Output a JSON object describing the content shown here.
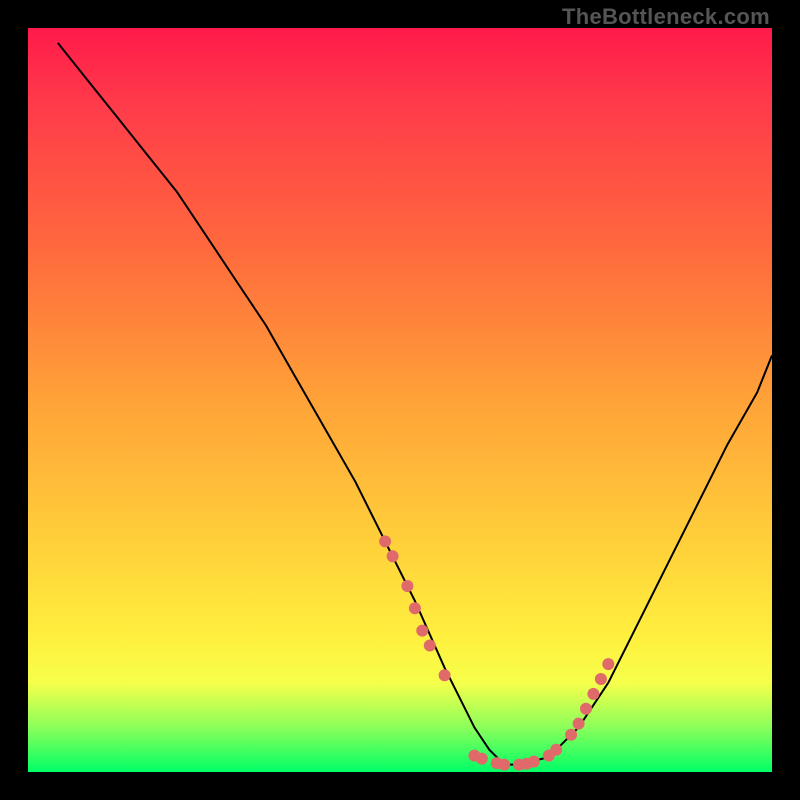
{
  "watermark": "TheBottleneck.com",
  "chart_data": {
    "type": "line",
    "title": "",
    "xlabel": "",
    "ylabel": "",
    "xlim": [
      0,
      100
    ],
    "ylim": [
      0,
      100
    ],
    "series": [
      {
        "name": "curve",
        "x": [
          4,
          8,
          12,
          16,
          20,
          24,
          28,
          32,
          36,
          40,
          44,
          48,
          52,
          56,
          58,
          60,
          62,
          64,
          66,
          70,
          74,
          78,
          82,
          86,
          90,
          94,
          98,
          100
        ],
        "y": [
          98,
          93,
          88,
          83,
          78,
          72,
          66,
          60,
          53,
          46,
          39,
          31,
          23,
          14,
          10,
          6,
          3,
          1,
          1,
          2,
          6,
          12,
          20,
          28,
          36,
          44,
          51,
          56
        ]
      }
    ],
    "markers": {
      "name": "highlight-dots",
      "color": "#e06a6a",
      "points": [
        {
          "x": 48,
          "y": 31
        },
        {
          "x": 49,
          "y": 29
        },
        {
          "x": 51,
          "y": 25
        },
        {
          "x": 52,
          "y": 22
        },
        {
          "x": 53,
          "y": 19
        },
        {
          "x": 54,
          "y": 17
        },
        {
          "x": 56,
          "y": 13
        },
        {
          "x": 60,
          "y": 2.2
        },
        {
          "x": 61,
          "y": 1.8
        },
        {
          "x": 63,
          "y": 1.2
        },
        {
          "x": 64,
          "y": 1.0
        },
        {
          "x": 66,
          "y": 1.0
        },
        {
          "x": 67,
          "y": 1.1
        },
        {
          "x": 68,
          "y": 1.4
        },
        {
          "x": 70,
          "y": 2.2
        },
        {
          "x": 71,
          "y": 3.0
        },
        {
          "x": 73,
          "y": 5.0
        },
        {
          "x": 74,
          "y": 6.5
        },
        {
          "x": 75,
          "y": 8.5
        },
        {
          "x": 76,
          "y": 10.5
        },
        {
          "x": 77,
          "y": 12.5
        },
        {
          "x": 78,
          "y": 14.5
        }
      ]
    }
  }
}
